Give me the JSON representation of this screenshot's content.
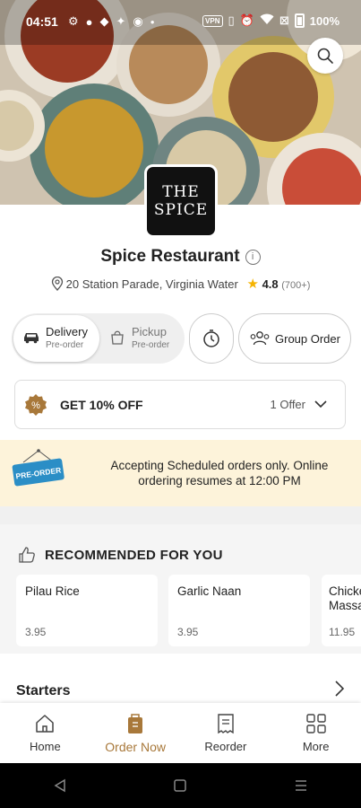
{
  "status_bar": {
    "time": "04:51",
    "vpn": "VPN",
    "battery": "100%"
  },
  "restaurant": {
    "logo_line1": "THE",
    "logo_line2": "SPICE",
    "name": "Spice Restaurant",
    "address": "20 Station Parade, Virginia Water",
    "rating": "4.8",
    "rating_count": "(700+)"
  },
  "order_mode": {
    "delivery_label": "Delivery",
    "delivery_sub": "Pre-order",
    "pickup_label": "Pickup",
    "pickup_sub": "Pre-order",
    "group_order_label": "Group Order"
  },
  "offer": {
    "title": "GET 10% OFF",
    "count": "1 Offer"
  },
  "notice": {
    "sign_text": "PRE-ORDER",
    "message": "Accepting Scheduled orders only. Online ordering resumes at 12:00 PM"
  },
  "recommended": {
    "heading": "RECOMMENDED FOR YOU",
    "items": [
      {
        "name": "Pilau Rice",
        "price": "3.95"
      },
      {
        "name": "Garlic Naan",
        "price": "3.95"
      },
      {
        "name": "Chicken Massa",
        "price": "11.95"
      }
    ]
  },
  "menu": {
    "first_category": "Starters"
  },
  "tabbar": {
    "home": "Home",
    "order_now": "Order Now",
    "reorder": "Reorder",
    "more": "More"
  },
  "colors": {
    "accent": "#a8783a",
    "notice_bg": "#fdf3da",
    "rating_star": "#f5b300"
  }
}
